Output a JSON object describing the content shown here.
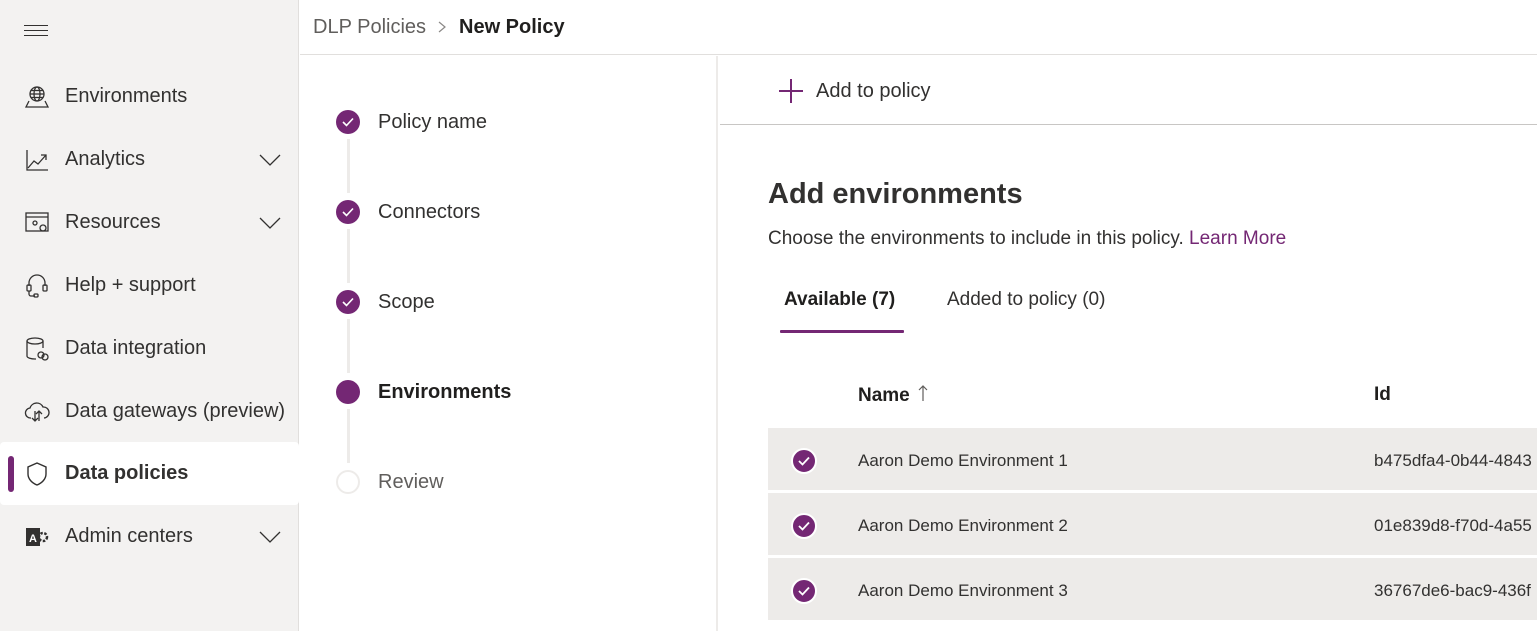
{
  "theme": {
    "accent": "#742774",
    "sidebar_bg": "#f3f2f1",
    "row_selected_bg": "#edebe9"
  },
  "sidebar": {
    "menu_icon": "hamburger-icon",
    "items": [
      {
        "label": "Environments",
        "icon": "globe-icon",
        "expandable": false,
        "selected": false
      },
      {
        "label": "Analytics",
        "icon": "chart-line-icon",
        "expandable": true,
        "selected": false
      },
      {
        "label": "Resources",
        "icon": "resources-settings-icon",
        "expandable": true,
        "selected": false
      },
      {
        "label": "Help + support",
        "icon": "headset-icon",
        "expandable": false,
        "selected": false
      },
      {
        "label": "Data integration",
        "icon": "database-link-icon",
        "expandable": false,
        "selected": false
      },
      {
        "label": "Data gateways (preview)",
        "icon": "cloud-upload-download-icon",
        "expandable": false,
        "selected": false
      },
      {
        "label": "Data policies",
        "icon": "shield-icon",
        "expandable": false,
        "selected": true
      },
      {
        "label": "Admin centers",
        "icon": "admin-center-icon",
        "expandable": true,
        "selected": false
      }
    ]
  },
  "breadcrumb": {
    "parent": "DLP Policies",
    "current": "New Policy"
  },
  "wizard": {
    "steps": [
      {
        "label": "Policy name",
        "state": "completed"
      },
      {
        "label": "Connectors",
        "state": "completed"
      },
      {
        "label": "Scope",
        "state": "completed"
      },
      {
        "label": "Environments",
        "state": "current"
      },
      {
        "label": "Review",
        "state": "pending"
      }
    ]
  },
  "command_bar": {
    "add_label": "Add to policy"
  },
  "content": {
    "title": "Add environments",
    "description": "Choose the environments to include in this policy.",
    "learn_more": "Learn More",
    "tabs": [
      {
        "label": "Available (7)",
        "active": true
      },
      {
        "label": "Added to policy (0)",
        "active": false
      }
    ],
    "table": {
      "columns": [
        {
          "label": "Name",
          "sort": "ascending"
        },
        {
          "label": "Id"
        }
      ],
      "rows": [
        {
          "selected": true,
          "name": "Aaron Demo Environment 1",
          "id": "b475dfa4-0b44-4843"
        },
        {
          "selected": true,
          "name": "Aaron Demo Environment 2",
          "id": "01e839d8-f70d-4a55"
        },
        {
          "selected": true,
          "name": "Aaron Demo Environment 3",
          "id": "36767de6-bac9-436f"
        }
      ]
    }
  }
}
